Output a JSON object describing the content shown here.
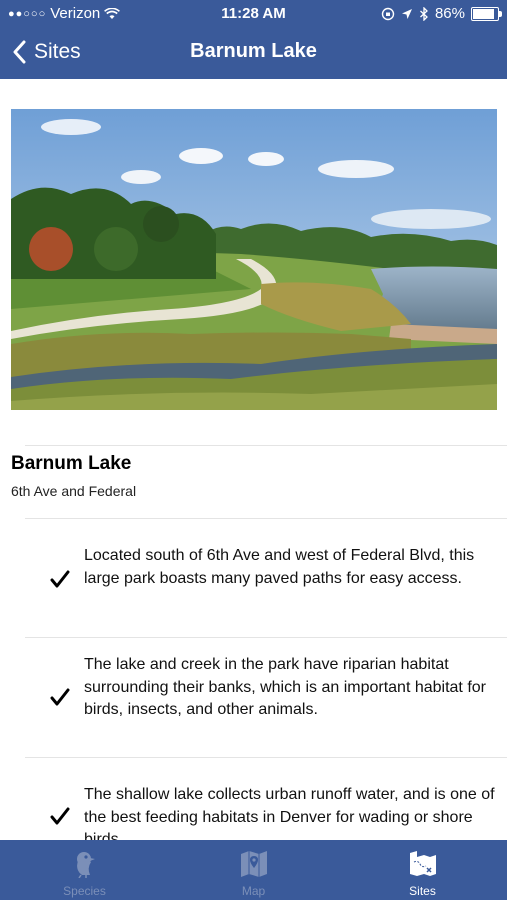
{
  "status_bar": {
    "signal": "●●○○○",
    "carrier": "Verizon",
    "time": "11:28 AM",
    "battery": "86%"
  },
  "nav": {
    "back_label": "Sites",
    "title": "Barnum Lake"
  },
  "site": {
    "name": "Barnum Lake",
    "address": "6th Ave and Federal",
    "facts": [
      "Located south of 6th Ave and west of Federal Blvd, this large park boasts many paved paths for easy access.",
      "The lake and creek in the park have riparian habitat surrounding their banks, which is an important habitat for birds, insects, and other animals.",
      "The shallow lake collects urban runoff water, and is one of the best feeding habitats in Denver for wading or shore birds."
    ]
  },
  "tabs": [
    {
      "label": "Species",
      "icon": "bird-icon",
      "active": false
    },
    {
      "label": "Map",
      "icon": "map-icon",
      "active": false
    },
    {
      "label": "Sites",
      "icon": "sites-map-icon",
      "active": true
    }
  ],
  "colors": {
    "bar_blue": "#3a5a9a",
    "tab_inactive": "#7b8fb8"
  }
}
